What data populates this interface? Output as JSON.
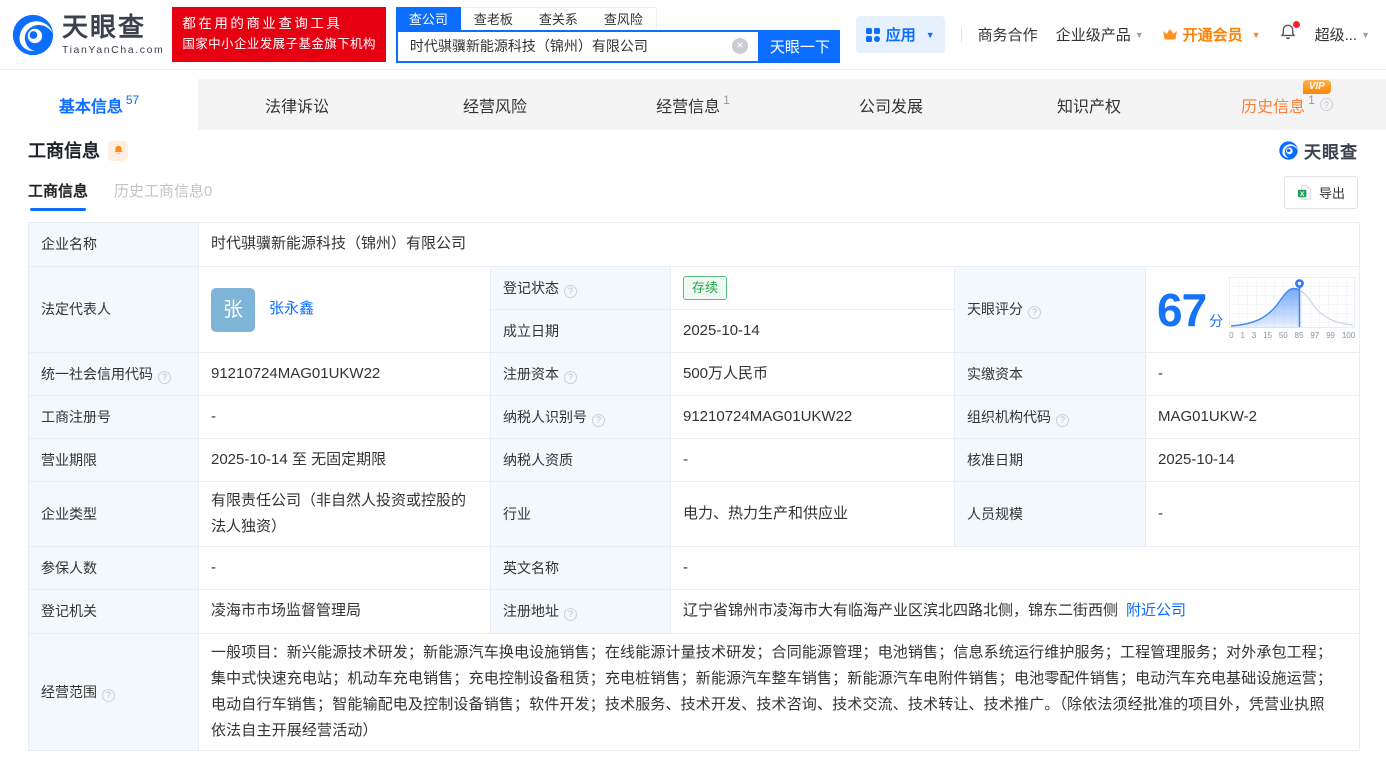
{
  "brand": {
    "name": "天眼查",
    "domain": "TianYanCha.com",
    "slogan1": "都在用的商业查询工具",
    "slogan2": "国家中小企业发展子基金旗下机构"
  },
  "search": {
    "tabs": [
      "查公司",
      "查老板",
      "查关系",
      "查风险"
    ],
    "value": "时代骐骥新能源科技（锦州）有限公司",
    "button": "天眼一下"
  },
  "menu": {
    "apps": "应用",
    "cooperation": "商务合作",
    "enterprise": "企业级产品",
    "vip": "开通会员",
    "super": "超级..."
  },
  "nav": {
    "tabs": [
      {
        "label": "基本信息",
        "sup": "57"
      },
      {
        "label": "法律诉讼",
        "sup": ""
      },
      {
        "label": "经营风险",
        "sup": ""
      },
      {
        "label": "经营信息",
        "sup": "1"
      },
      {
        "label": "公司发展",
        "sup": ""
      },
      {
        "label": "知识产权",
        "sup": ""
      },
      {
        "label": "历史信息",
        "sup": "1",
        "vip": "VIP"
      }
    ]
  },
  "section": {
    "title": "工商信息",
    "watermark": "天眼查",
    "subtab_active": "工商信息",
    "subtab_history": "历史工商信息0",
    "export": "导出"
  },
  "table": {
    "company_name": {
      "label": "企业名称",
      "value": "时代骐骥新能源科技（锦州）有限公司"
    },
    "legal_rep": {
      "label": "法定代表人",
      "avatar": "张",
      "name": "张永鑫"
    },
    "reg_status": {
      "label": "登记状态",
      "value": "存续"
    },
    "est_date": {
      "label": "成立日期",
      "value": "2025-10-14"
    },
    "score": {
      "label": "天眼评分",
      "value": "67",
      "unit": "分",
      "axis": [
        "0",
        "1",
        "3",
        "15",
        "50",
        "85",
        "97",
        "99",
        "100"
      ]
    },
    "credit_code": {
      "label": "统一社会信用代码",
      "value": "91210724MAG01UKW22"
    },
    "reg_capital": {
      "label": "注册资本",
      "value": "500万人民币"
    },
    "paid_capital": {
      "label": "实缴资本",
      "value": "-"
    },
    "reg_number": {
      "label": "工商注册号",
      "value": "-"
    },
    "taxpayer_id": {
      "label": "纳税人识别号",
      "value": "91210724MAG01UKW22"
    },
    "org_code": {
      "label": "组织机构代码",
      "value": "MAG01UKW-2"
    },
    "business_term": {
      "label": "营业期限",
      "value": "2025-10-14 至 无固定期限"
    },
    "taxpayer_quality": {
      "label": "纳税人资质",
      "value": "-"
    },
    "approval_date": {
      "label": "核准日期",
      "value": "2025-10-14"
    },
    "company_type": {
      "label": "企业类型",
      "value": "有限责任公司（非自然人投资或控股的法人独资）"
    },
    "industry": {
      "label": "行业",
      "value": "电力、热力生产和供应业"
    },
    "staff_size": {
      "label": "人员规模",
      "value": "-"
    },
    "insured_count": {
      "label": "参保人数",
      "value": "-"
    },
    "english_name": {
      "label": "英文名称",
      "value": "-"
    },
    "reg_authority": {
      "label": "登记机关",
      "value": "凌海市市场监督管理局"
    },
    "reg_address": {
      "label": "注册地址",
      "value": "辽宁省锦州市凌海市大有临海产业区滨北四路北侧，锦东二街西侧",
      "link": "附近公司"
    },
    "business_scope": {
      "label": "经营范围",
      "value": "一般项目：新兴能源技术研发；新能源汽车换电设施销售；在线能源计量技术研发；合同能源管理；电池销售；信息系统运行维护服务；工程管理服务；对外承包工程；集中式快速充电站；机动车充电销售；充电控制设备租赁；充电桩销售；新能源汽车整车销售；新能源汽车电附件销售；电池零配件销售；电动汽车充电基础设施运营；电动自行车销售；智能输配电及控制设备销售；软件开发；技术服务、技术开发、技术咨询、技术交流、技术转让、技术推广。（除依法须经批准的项目外，凭营业执照依法自主开展经营活动）"
    }
  },
  "icons": {
    "help": "?",
    "clear": "×"
  }
}
